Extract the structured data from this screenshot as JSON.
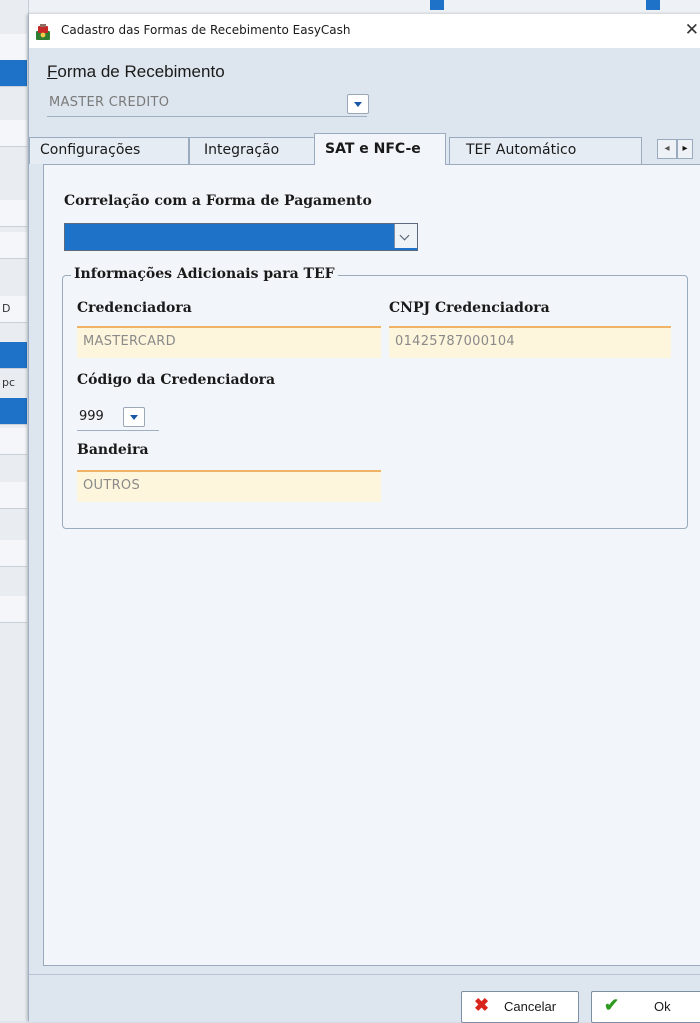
{
  "window": {
    "title": "Cadastro das Formas de Recebimento EasyCash",
    "close_glyph": "✕"
  },
  "forma_recebimento": {
    "label_access_key": "F",
    "label_rest": "orma de Recebimento",
    "value": "MASTER CREDITO"
  },
  "tabs": [
    {
      "label": "Configurações",
      "active": false
    },
    {
      "label": "Integração",
      "active": false
    },
    {
      "label": "SAT e NFC-e",
      "active": true
    },
    {
      "label": "TEF Automático",
      "active": false
    }
  ],
  "sat_nfce": {
    "correlacao_label": "Correlação com a Forma de Pagamento",
    "correlacao_value": "",
    "tef_group": {
      "legend": "Informações Adicionais para TEF",
      "credenciadora_label": "Credenciadora",
      "credenciadora_value": "MASTERCARD",
      "cnpj_label": "CNPJ Credenciadora",
      "cnpj_value": "01425787000104",
      "codigo_label": "Código da Credenciadora",
      "codigo_value": "999",
      "bandeira_label": "Bandeira",
      "bandeira_value": "OUTROS"
    }
  },
  "background": {
    "left_letters": [
      "D",
      "pc"
    ]
  },
  "footer": {
    "cancel_label": "Cancelar",
    "ok_label": "Ok"
  },
  "colors": {
    "accent": "#1e73c8",
    "field_highlight": "#fdf6dc",
    "field_border": "#f0b469",
    "cancel_icon": "#d9261c",
    "ok_icon": "#2e9a1f"
  },
  "icons": {
    "app": "easycash-app-icon",
    "cancel": "x-icon",
    "ok": "check-icon",
    "dropdown": "chevron-down-icon"
  }
}
